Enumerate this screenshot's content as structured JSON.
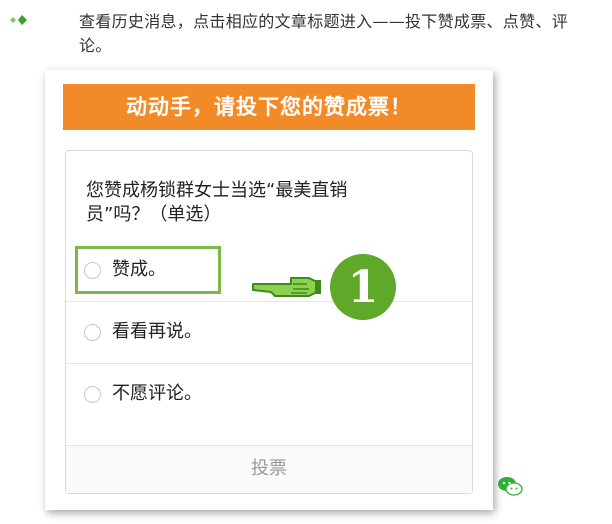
{
  "instruction": {
    "text": "查看历史消息，点击相应的文章标题进入——投下赞成票、点赞、评论。"
  },
  "vote_page": {
    "banner": "动动手，请投下您的赞成票！",
    "question": "您赞成杨锁群女士当选“最美直销员”吗？（单选）",
    "options": [
      {
        "label": "赞成。"
      },
      {
        "label": "看看再说。"
      },
      {
        "label": "不愿评论。"
      }
    ],
    "submit_label": "投票"
  },
  "annotation": {
    "step_number": "1",
    "pointer_icon": "pointing-hand-icon",
    "highlight_color": "#7db84a",
    "badge_color": "#5fa82a"
  },
  "colors": {
    "banner": "#f28a28",
    "bullet": "#4caf50"
  },
  "icons": {
    "bullet": "green-diamond-bullet-icon",
    "watermark": "wechat-icon"
  }
}
